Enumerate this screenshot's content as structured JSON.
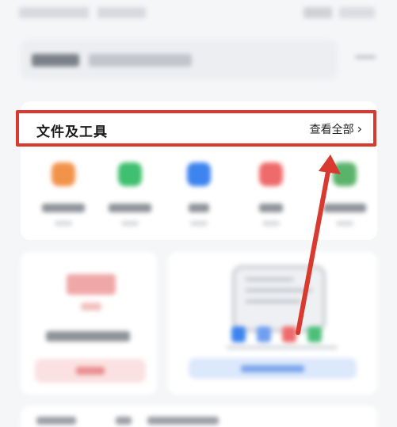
{
  "section": {
    "title": "文件及工具",
    "view_all": "查看全部",
    "chevron": "›"
  },
  "annotation": {
    "highlight_color": "#d93a30",
    "arrow_color": "#d93a30"
  },
  "tools": [
    {
      "icon": "folder-icon",
      "color": "#f2934a"
    },
    {
      "icon": "chat-file-icon",
      "color": "#3fbf6f"
    },
    {
      "icon": "image-icon",
      "color": "#3d84ee"
    },
    {
      "icon": "video-icon",
      "color": "#ef6a6a"
    },
    {
      "icon": "album-icon",
      "color": "#5bb36b"
    }
  ]
}
